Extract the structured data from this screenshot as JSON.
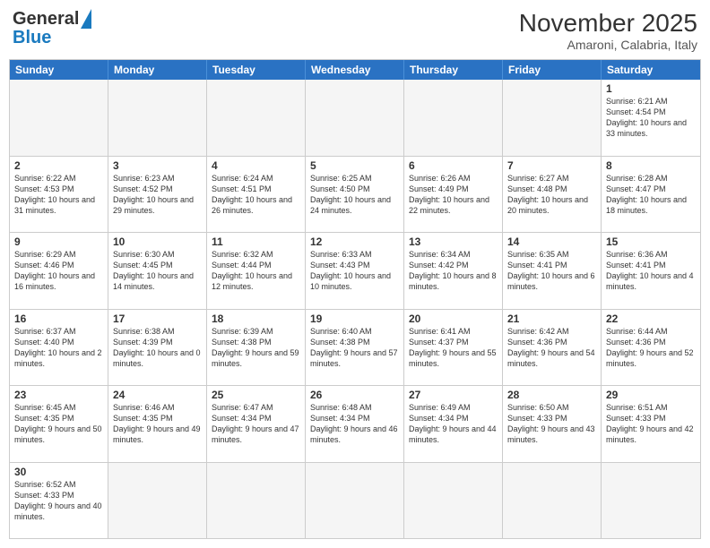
{
  "header": {
    "logo_general": "General",
    "logo_blue": "Blue",
    "month_year": "November 2025",
    "location": "Amaroni, Calabria, Italy"
  },
  "day_headers": [
    "Sunday",
    "Monday",
    "Tuesday",
    "Wednesday",
    "Thursday",
    "Friday",
    "Saturday"
  ],
  "weeks": [
    [
      {
        "num": "",
        "info": "",
        "empty": true
      },
      {
        "num": "",
        "info": "",
        "empty": true
      },
      {
        "num": "",
        "info": "",
        "empty": true
      },
      {
        "num": "",
        "info": "",
        "empty": true
      },
      {
        "num": "",
        "info": "",
        "empty": true
      },
      {
        "num": "",
        "info": "",
        "empty": true
      },
      {
        "num": "1",
        "info": "Sunrise: 6:21 AM\nSunset: 4:54 PM\nDaylight: 10 hours and 33 minutes.",
        "empty": false
      }
    ],
    [
      {
        "num": "2",
        "info": "Sunrise: 6:22 AM\nSunset: 4:53 PM\nDaylight: 10 hours and 31 minutes.",
        "empty": false
      },
      {
        "num": "3",
        "info": "Sunrise: 6:23 AM\nSunset: 4:52 PM\nDaylight: 10 hours and 29 minutes.",
        "empty": false
      },
      {
        "num": "4",
        "info": "Sunrise: 6:24 AM\nSunset: 4:51 PM\nDaylight: 10 hours and 26 minutes.",
        "empty": false
      },
      {
        "num": "5",
        "info": "Sunrise: 6:25 AM\nSunset: 4:50 PM\nDaylight: 10 hours and 24 minutes.",
        "empty": false
      },
      {
        "num": "6",
        "info": "Sunrise: 6:26 AM\nSunset: 4:49 PM\nDaylight: 10 hours and 22 minutes.",
        "empty": false
      },
      {
        "num": "7",
        "info": "Sunrise: 6:27 AM\nSunset: 4:48 PM\nDaylight: 10 hours and 20 minutes.",
        "empty": false
      },
      {
        "num": "8",
        "info": "Sunrise: 6:28 AM\nSunset: 4:47 PM\nDaylight: 10 hours and 18 minutes.",
        "empty": false
      }
    ],
    [
      {
        "num": "9",
        "info": "Sunrise: 6:29 AM\nSunset: 4:46 PM\nDaylight: 10 hours and 16 minutes.",
        "empty": false
      },
      {
        "num": "10",
        "info": "Sunrise: 6:30 AM\nSunset: 4:45 PM\nDaylight: 10 hours and 14 minutes.",
        "empty": false
      },
      {
        "num": "11",
        "info": "Sunrise: 6:32 AM\nSunset: 4:44 PM\nDaylight: 10 hours and 12 minutes.",
        "empty": false
      },
      {
        "num": "12",
        "info": "Sunrise: 6:33 AM\nSunset: 4:43 PM\nDaylight: 10 hours and 10 minutes.",
        "empty": false
      },
      {
        "num": "13",
        "info": "Sunrise: 6:34 AM\nSunset: 4:42 PM\nDaylight: 10 hours and 8 minutes.",
        "empty": false
      },
      {
        "num": "14",
        "info": "Sunrise: 6:35 AM\nSunset: 4:41 PM\nDaylight: 10 hours and 6 minutes.",
        "empty": false
      },
      {
        "num": "15",
        "info": "Sunrise: 6:36 AM\nSunset: 4:41 PM\nDaylight: 10 hours and 4 minutes.",
        "empty": false
      }
    ],
    [
      {
        "num": "16",
        "info": "Sunrise: 6:37 AM\nSunset: 4:40 PM\nDaylight: 10 hours and 2 minutes.",
        "empty": false
      },
      {
        "num": "17",
        "info": "Sunrise: 6:38 AM\nSunset: 4:39 PM\nDaylight: 10 hours and 0 minutes.",
        "empty": false
      },
      {
        "num": "18",
        "info": "Sunrise: 6:39 AM\nSunset: 4:38 PM\nDaylight: 9 hours and 59 minutes.",
        "empty": false
      },
      {
        "num": "19",
        "info": "Sunrise: 6:40 AM\nSunset: 4:38 PM\nDaylight: 9 hours and 57 minutes.",
        "empty": false
      },
      {
        "num": "20",
        "info": "Sunrise: 6:41 AM\nSunset: 4:37 PM\nDaylight: 9 hours and 55 minutes.",
        "empty": false
      },
      {
        "num": "21",
        "info": "Sunrise: 6:42 AM\nSunset: 4:36 PM\nDaylight: 9 hours and 54 minutes.",
        "empty": false
      },
      {
        "num": "22",
        "info": "Sunrise: 6:44 AM\nSunset: 4:36 PM\nDaylight: 9 hours and 52 minutes.",
        "empty": false
      }
    ],
    [
      {
        "num": "23",
        "info": "Sunrise: 6:45 AM\nSunset: 4:35 PM\nDaylight: 9 hours and 50 minutes.",
        "empty": false
      },
      {
        "num": "24",
        "info": "Sunrise: 6:46 AM\nSunset: 4:35 PM\nDaylight: 9 hours and 49 minutes.",
        "empty": false
      },
      {
        "num": "25",
        "info": "Sunrise: 6:47 AM\nSunset: 4:34 PM\nDaylight: 9 hours and 47 minutes.",
        "empty": false
      },
      {
        "num": "26",
        "info": "Sunrise: 6:48 AM\nSunset: 4:34 PM\nDaylight: 9 hours and 46 minutes.",
        "empty": false
      },
      {
        "num": "27",
        "info": "Sunrise: 6:49 AM\nSunset: 4:34 PM\nDaylight: 9 hours and 44 minutes.",
        "empty": false
      },
      {
        "num": "28",
        "info": "Sunrise: 6:50 AM\nSunset: 4:33 PM\nDaylight: 9 hours and 43 minutes.",
        "empty": false
      },
      {
        "num": "29",
        "info": "Sunrise: 6:51 AM\nSunset: 4:33 PM\nDaylight: 9 hours and 42 minutes.",
        "empty": false
      }
    ],
    [
      {
        "num": "30",
        "info": "Sunrise: 6:52 AM\nSunset: 4:33 PM\nDaylight: 9 hours and 40 minutes.",
        "empty": false
      },
      {
        "num": "",
        "info": "",
        "empty": true
      },
      {
        "num": "",
        "info": "",
        "empty": true
      },
      {
        "num": "",
        "info": "",
        "empty": true
      },
      {
        "num": "",
        "info": "",
        "empty": true
      },
      {
        "num": "",
        "info": "",
        "empty": true
      },
      {
        "num": "",
        "info": "",
        "empty": true
      }
    ]
  ]
}
